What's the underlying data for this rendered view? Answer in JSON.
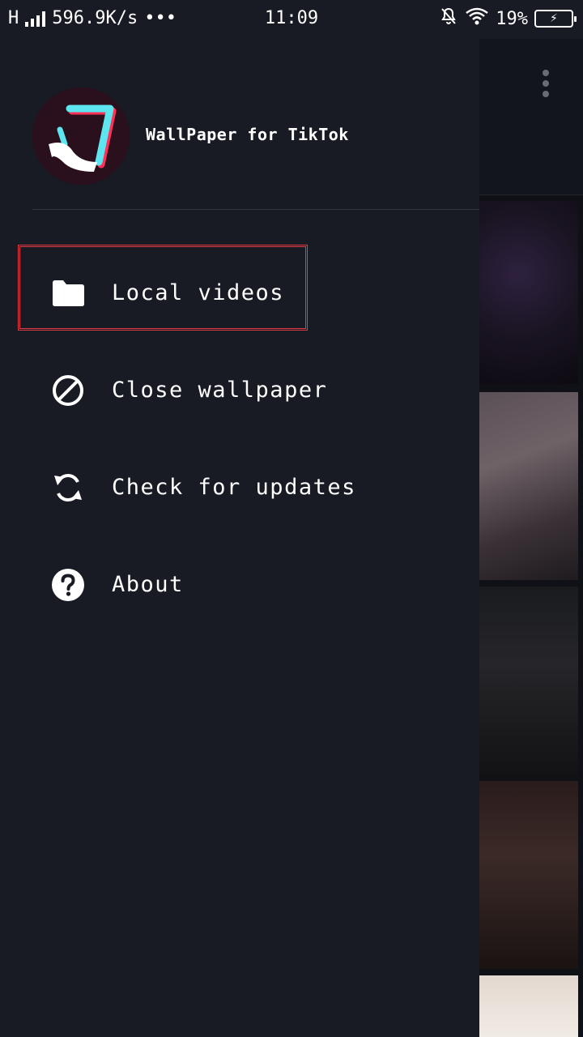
{
  "status_bar": {
    "network_type": "H",
    "speed": "596.9K/s",
    "more": "•••",
    "time": "11:09",
    "battery_percent": "19%",
    "icons": [
      "signal-icon",
      "mute-bell-icon",
      "wifi-icon",
      "battery-charging-icon"
    ]
  },
  "drawer": {
    "app_title": "WallPaper for TikTok",
    "menu": [
      {
        "label": "Local videos",
        "icon": "folder-icon",
        "selected": true
      },
      {
        "label": "Close wallpaper",
        "icon": "block-icon",
        "selected": false
      },
      {
        "label": "Check for updates",
        "icon": "refresh-icon",
        "selected": false
      },
      {
        "label": "About",
        "icon": "help-icon",
        "selected": false
      }
    ]
  },
  "colors": {
    "drawer_bg": "#181a24",
    "selection_outline": "#e23b46",
    "logo_cyan": "#5ee6f0",
    "logo_red": "#ff3158"
  }
}
